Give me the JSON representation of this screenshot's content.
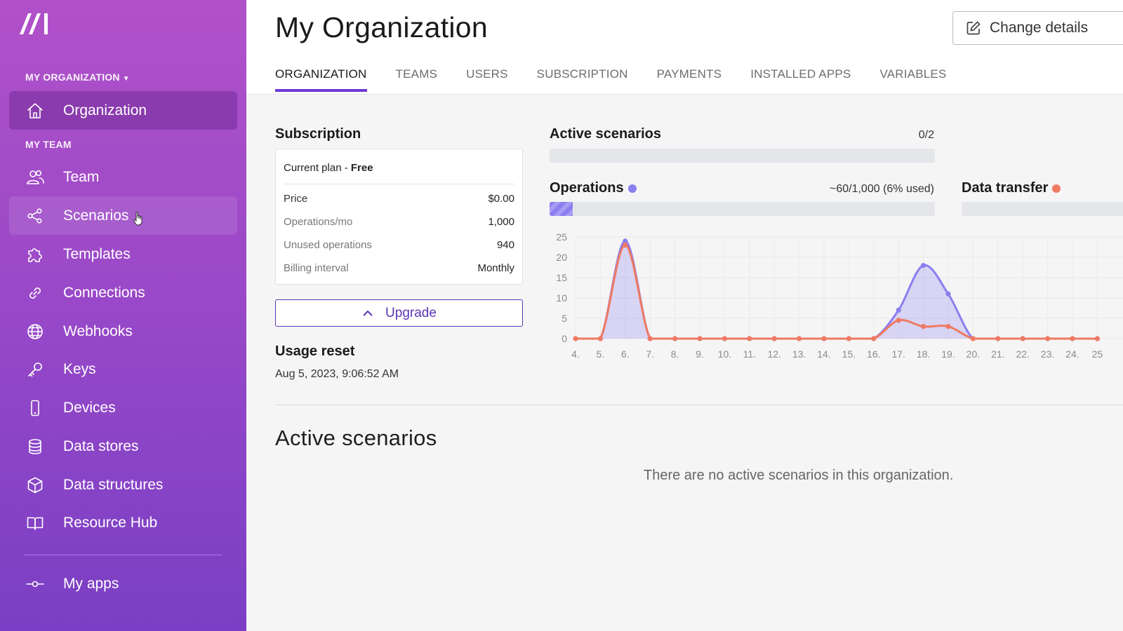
{
  "sidebar": {
    "org_label": "MY ORGANIZATION",
    "team_label": "MY TEAM",
    "org_item": {
      "label": "Organization",
      "icon": "home-icon"
    },
    "items": [
      {
        "label": "Team",
        "icon": "users-icon"
      },
      {
        "label": "Scenarios",
        "icon": "share-nodes-icon"
      },
      {
        "label": "Templates",
        "icon": "puzzle-icon"
      },
      {
        "label": "Connections",
        "icon": "link-icon"
      },
      {
        "label": "Webhooks",
        "icon": "globe-icon"
      },
      {
        "label": "Keys",
        "icon": "key-icon"
      },
      {
        "label": "Devices",
        "icon": "mobile-icon"
      },
      {
        "label": "Data stores",
        "icon": "database-icon"
      },
      {
        "label": "Data structures",
        "icon": "cube-icon"
      },
      {
        "label": "Resource Hub",
        "icon": "book-icon"
      }
    ],
    "bottom_item": {
      "label": "My apps",
      "icon": "commit-icon"
    }
  },
  "header": {
    "title": "My Organization",
    "change_details": "Change details",
    "tabs": [
      "ORGANIZATION",
      "TEAMS",
      "USERS",
      "SUBSCRIPTION",
      "PAYMENTS",
      "INSTALLED APPS",
      "VARIABLES"
    ],
    "active_tab": "ORGANIZATION"
  },
  "subscription": {
    "title": "Subscription",
    "plan_prefix": "Current plan - ",
    "plan_name": "Free",
    "rows": [
      {
        "key": "Price",
        "value": "$0.00"
      },
      {
        "key": "Operations/mo",
        "value": "1,000"
      },
      {
        "key": "Unused operations",
        "value": "940"
      },
      {
        "key": "Billing interval",
        "value": "Monthly"
      }
    ],
    "upgrade_label": "Upgrade",
    "usage_reset_title": "Usage reset",
    "usage_reset_date": "Aug 5, 2023, 9:06:52 AM"
  },
  "metrics": {
    "active_scenarios": {
      "title": "Active scenarios",
      "value": "0/2",
      "fraction": 0
    },
    "operations": {
      "title": "Operations",
      "value": "~60/1,000 (6% used)",
      "fraction": 0.06,
      "color": "#8b7ef0"
    },
    "data_transfer": {
      "title": "Data transfer",
      "color": "#f07a62"
    }
  },
  "chart_data": {
    "type": "line",
    "x": [
      "4.",
      "5.",
      "6.",
      "7.",
      "8.",
      "9.",
      "10.",
      "11.",
      "12.",
      "13.",
      "14.",
      "15.",
      "16.",
      "17.",
      "18.",
      "19.",
      "20.",
      "21.",
      "22.",
      "23.",
      "24.",
      "25"
    ],
    "ylim": [
      0,
      25
    ],
    "yticks": [
      0,
      5,
      10,
      15,
      20,
      25
    ],
    "grid": true,
    "series": [
      {
        "name": "Operations",
        "color": "#8b7ef0",
        "values": [
          0,
          0,
          24,
          0,
          0,
          0,
          0,
          0,
          0,
          0,
          0,
          0,
          0,
          7,
          18,
          11,
          0,
          0,
          0,
          0,
          0,
          0
        ]
      },
      {
        "name": "Data transfer",
        "color": "#f07a62",
        "values": [
          0,
          0,
          23,
          0,
          0,
          0,
          0,
          0,
          0,
          0,
          0,
          0,
          0,
          4.5,
          3,
          3,
          0,
          0,
          0,
          0,
          0,
          0
        ]
      }
    ]
  },
  "active_section": {
    "title": "Active scenarios",
    "empty_message": "There are no active scenarios in this organization."
  }
}
